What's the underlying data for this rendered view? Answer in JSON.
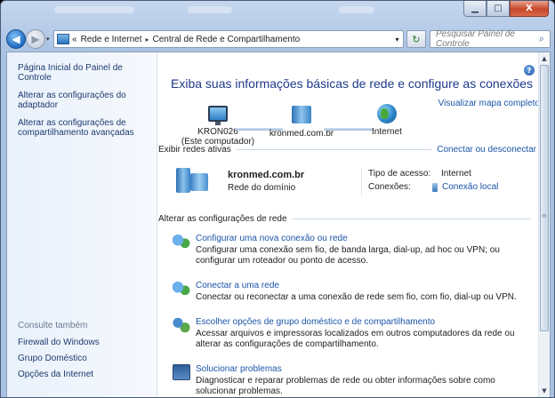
{
  "window": {
    "minimize_glyph": "▁",
    "maximize_glyph": "□",
    "close_glyph": "X"
  },
  "navbar": {
    "back_glyph": "◀",
    "forward_glyph": "▶",
    "dropdown_glyph": "▾",
    "address": {
      "prefix": "«",
      "segments": [
        "Rede e Internet",
        "Central de Rede e Compartilhamento"
      ],
      "separator": "▸",
      "dropdown_glyph": "▾"
    },
    "refresh_glyph": "↻",
    "search": {
      "placeholder": "Pesquisar Painel de Controle",
      "icon": "search-icon",
      "icon_glyph": "⌕"
    }
  },
  "left_pane": {
    "links": [
      "Página Inicial do Painel de Controle",
      "Alterar as configurações do adaptador",
      "Alterar as configurações de compartilhamento avançadas"
    ],
    "see_also": {
      "title": "Consulte também",
      "links": [
        "Firewall do Windows",
        "Grupo Doméstico",
        "Opções da Internet"
      ]
    }
  },
  "main": {
    "help_glyph": "?",
    "title": "Exiba suas informações básicas de rede e configure as conexões",
    "map_link": "Visualizar mapa completo",
    "map": {
      "computer": {
        "name": "KRON026",
        "sub": "(Este computador)",
        "icon": "computer-icon"
      },
      "domain": {
        "name": "kronmed.com.br",
        "icon": "domain-icon"
      },
      "internet": {
        "name": "Internet",
        "icon": "globe-icon"
      }
    },
    "active_networks": {
      "header": "Exibir redes ativas",
      "link": "Conectar ou desconectar",
      "network": {
        "name": "kronmed.com.br",
        "type": "Rede do domínio",
        "access_label": "Tipo de acesso:",
        "access_value": "Internet",
        "connections_label": "Conexões:",
        "connections_value": "Conexão local"
      }
    },
    "change_settings": {
      "header": "Alterar as configurações de rede",
      "tasks": [
        {
          "title": "Configurar uma nova conexão ou rede",
          "desc": "Configurar uma conexão sem fio, de banda larga, dial-up, ad hoc ou VPN; ou configurar um roteador ou ponto de acesso.",
          "icon": "network-setup-icon"
        },
        {
          "title": "Conectar a uma rede",
          "desc": "Conectar ou reconectar a uma conexão de rede sem fio, com fio, dial-up ou VPN.",
          "icon": "connect-network-icon"
        },
        {
          "title": "Escolher opções de grupo doméstico e de compartilhamento",
          "desc": "Acessar arquivos e impressoras localizados em outros computadores da rede ou alterar as configurações de compartilhamento.",
          "icon": "homegroup-icon"
        },
        {
          "title": "Solucionar problemas",
          "desc": "Diagnosticar e reparar problemas de rede ou obter informações sobre como solucionar problemas.",
          "icon": "troubleshoot-icon"
        }
      ]
    }
  },
  "scrollbar": {
    "up_glyph": "▲",
    "down_glyph": "▼",
    "grip_glyph": "≡"
  }
}
